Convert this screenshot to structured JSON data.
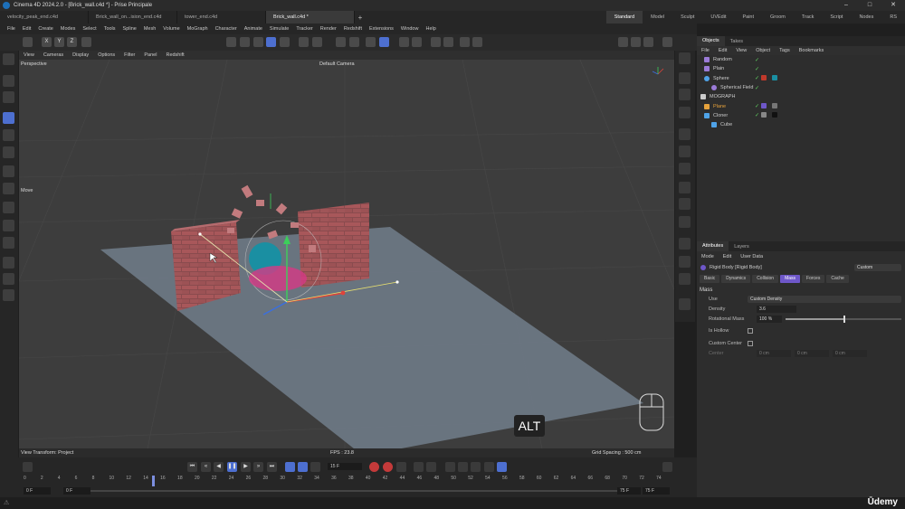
{
  "window": {
    "title": "Cinema 4D 2024.2.0 - [Brick_wall.c4d *] - Prise Principale"
  },
  "doc_tabs": [
    "velocity_peak_end.c4d",
    "Brick_wall_on...ision_end.c4d",
    "tower_end.c4d",
    "Brick_wall.c4d *"
  ],
  "layouts": [
    "Standard",
    "Model",
    "Sculpt",
    "UVEdit",
    "Paint",
    "Groom",
    "Track",
    "Script",
    "Nodes",
    "RS"
  ],
  "menu": [
    "File",
    "Edit",
    "Create",
    "Modes",
    "Select",
    "Tools",
    "Spline",
    "Mesh",
    "Volume",
    "MoGraph",
    "Character",
    "Animate",
    "Simulate",
    "Tracker",
    "Render",
    "Redshift",
    "Extensions",
    "Window",
    "Help"
  ],
  "toolbar_axes": [
    "X",
    "Y",
    "Z"
  ],
  "viewport": {
    "menu": [
      "View",
      "Cameras",
      "Display",
      "Options",
      "Filter",
      "Panel",
      "Redshift"
    ],
    "view_name": "Perspective",
    "camera": "Default Camera",
    "move_label": "Move",
    "view_transform": "View Transform: Project",
    "fps": "FPS : 23.8",
    "grid_spacing": "Grid Spacing : 500 cm",
    "alt_key": "ALT"
  },
  "objects_panel": {
    "tabs": [
      "Objects",
      "Takes"
    ],
    "menu": [
      "File",
      "Edit",
      "View",
      "Object",
      "Tags",
      "Bookmarks"
    ],
    "items": [
      {
        "name": "Random",
        "indent": 1,
        "color": "#9b7bd8"
      },
      {
        "name": "Plain",
        "indent": 1,
        "color": "#9b7bd8"
      },
      {
        "name": "Sphere",
        "indent": 1,
        "color": "#4fa3e8"
      },
      {
        "name": "Spherical Field",
        "indent": 2,
        "color": "#9b7bd8"
      },
      {
        "name": "MOGRAPH",
        "indent": 0,
        "color": "#cccccc"
      },
      {
        "name": "Plane",
        "indent": 1,
        "color": "#e6a23c"
      },
      {
        "name": "Cloner",
        "indent": 1,
        "color": "#4fa3e8"
      },
      {
        "name": "Cube",
        "indent": 2,
        "color": "#4fa3e8"
      }
    ]
  },
  "attributes_panel": {
    "tabs": [
      "Attributes",
      "Layers"
    ],
    "menu": [
      "Mode",
      "Edit",
      "User Data"
    ],
    "object_title": "Rigid Body [Rigid Body]",
    "preset": "Custom",
    "tag_tabs": [
      "Basic",
      "Dynamics",
      "Collision",
      "Mass",
      "Forces",
      "Cache"
    ],
    "active_tab": "Mass",
    "section": "Mass",
    "fields": {
      "use_label": "Use",
      "use_value": "Custom Density",
      "density_label": "Density",
      "density_value": "3.6",
      "rotational_mass_label": "Rotational Mass",
      "rotational_mass_value": "100 %",
      "is_hollow_label": "Is Hollow",
      "custom_center_label": "Custom Center",
      "center_label": "Center",
      "center_values": [
        "0 cm",
        "0 cm",
        "0 cm"
      ]
    }
  },
  "timeline": {
    "current_frame": "15 F",
    "ruler_ticks": [
      "0",
      "2",
      "4",
      "6",
      "8",
      "10",
      "12",
      "14",
      "16",
      "18",
      "20",
      "22",
      "24",
      "26",
      "28",
      "30",
      "32",
      "34",
      "36",
      "38",
      "40",
      "42",
      "44",
      "46",
      "48",
      "50",
      "52",
      "54",
      "56",
      "58",
      "60",
      "62",
      "64",
      "66",
      "68",
      "70",
      "72",
      "74"
    ],
    "start_a": "0 F",
    "start_b": "0 F",
    "end_a": "75 F",
    "end_b": "75 F"
  },
  "watermark": "Ūdemy",
  "colors": {
    "accent": "#4d6fd0",
    "mass_tab": "#6e57c9",
    "record": "#c43a3a"
  }
}
